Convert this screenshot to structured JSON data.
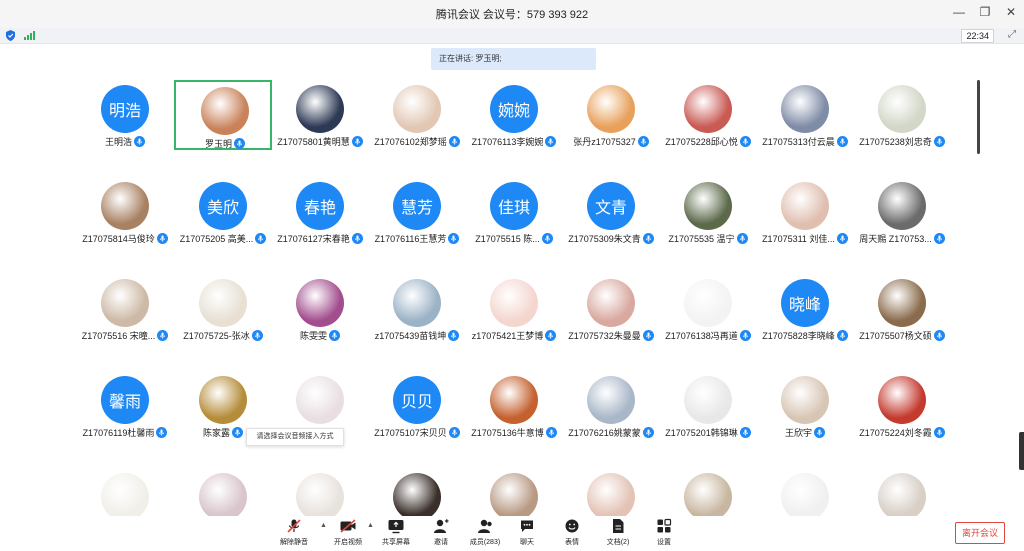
{
  "window": {
    "title": "腾讯会议 会议号：579 393 922",
    "controls": [
      "minimize-icon",
      "restore-icon",
      "close-icon"
    ]
  },
  "status": {
    "time": "22:34"
  },
  "speaking_banner": "正在讲话: 罗玉明;",
  "participants": [
    {
      "name": "王明浩",
      "avatar_text": "明浩",
      "avatar_color": "#1e88f5"
    },
    {
      "name": "罗玉明",
      "avatar_color": "#c9825a",
      "selected": true
    },
    {
      "name": "Z17075801黄明慧",
      "avatar_color": "#2d3a55"
    },
    {
      "name": "Z17076102郑梦瑶",
      "avatar_color": "#e2c8b4"
    },
    {
      "name": "Z17076113李婉婉",
      "avatar_text": "婉婉",
      "avatar_color": "#1e88f5"
    },
    {
      "name": "张丹z17075327",
      "avatar_color": "#e8a15c"
    },
    {
      "name": "Z17075228邱心悦",
      "avatar_color": "#c95a54"
    },
    {
      "name": "Z17075313付云晨",
      "avatar_color": "#7f8ca6"
    },
    {
      "name": "Z17075238刘忠奇",
      "avatar_color": "#d2d7c8"
    },
    {
      "name": "Z17075814马俊玲",
      "avatar_color": "#a88162"
    },
    {
      "name": "Z17075205 高美...",
      "avatar_text": "美欣",
      "avatar_color": "#1e88f5"
    },
    {
      "name": "Z17076127宋春艳",
      "avatar_text": "春艳",
      "avatar_color": "#1e88f5"
    },
    {
      "name": "Z17076116王慧芳",
      "avatar_text": "慧芳",
      "avatar_color": "#1e88f5"
    },
    {
      "name": "Z17075515  陈...",
      "avatar_text": "佳琪",
      "avatar_color": "#1e88f5"
    },
    {
      "name": "Z17075309朱文青",
      "avatar_text": "文青",
      "avatar_color": "#1e88f5"
    },
    {
      "name": "Z17075535 温宁",
      "avatar_color": "#5c6a4a"
    },
    {
      "name": "Z17075311 刘佳...",
      "avatar_color": "#e0bfb0"
    },
    {
      "name": "周天赐 Z170753...",
      "avatar_color": "#6b6b6b"
    },
    {
      "name": "Z17075516 宋曈...",
      "avatar_color": "#cdb9a5"
    },
    {
      "name": "Z17075725-张冰",
      "avatar_color": "#e7e0d3"
    },
    {
      "name": "陈雯雯",
      "avatar_color": "#a24d8e"
    },
    {
      "name": "z17075439苗钱坤",
      "avatar_color": "#9bb3c6"
    },
    {
      "name": "z17075421王梦博",
      "avatar_color": "#f4d6cf"
    },
    {
      "name": "Z17075732朱曼曼",
      "avatar_color": "#d9a9a0"
    },
    {
      "name": "Z17076138冯再道",
      "avatar_color": "#f3f3f3"
    },
    {
      "name": "Z17075828李晓峰",
      "avatar_text": "晓峰",
      "avatar_color": "#1e88f5"
    },
    {
      "name": "Z17075507杨文硕",
      "avatar_color": "#8a6b4c"
    },
    {
      "name": "Z17076119杜馨雨",
      "avatar_text": "馨雨",
      "avatar_color": "#1e88f5"
    },
    {
      "name": "陈家露",
      "avatar_color": "#b58d3a"
    },
    {
      "name": "",
      "avatar_color": "#e9dfe3"
    },
    {
      "name": "Z17075107宋贝贝",
      "avatar_text": "贝贝",
      "avatar_color": "#1e88f5"
    },
    {
      "name": "Z17075136牛意博",
      "avatar_color": "#c4612f"
    },
    {
      "name": "Z17076216姚蒙蒙",
      "avatar_color": "#a9b7c8"
    },
    {
      "name": "Z17075201韩锦琳",
      "avatar_color": "#e8e8e8"
    },
    {
      "name": "王欣宇",
      "avatar_color": "#d8c6b5"
    },
    {
      "name": "Z17075224刘冬霞",
      "avatar_color": "#c43a2f"
    },
    {
      "name": "",
      "avatar_color": "#f1efe8"
    },
    {
      "name": "",
      "avatar_color": "#d9c5cc"
    },
    {
      "name": "",
      "avatar_color": "#e8e2dc"
    },
    {
      "name": "",
      "avatar_color": "#3a2f2a"
    },
    {
      "name": "",
      "avatar_color": "#b89a84"
    },
    {
      "name": "",
      "avatar_color": "#e3c3b5"
    },
    {
      "name": "",
      "avatar_color": "#c8b7a0"
    },
    {
      "name": "",
      "avatar_color": "#f0f0f0"
    },
    {
      "name": "",
      "avatar_color": "#d8cfc6"
    }
  ],
  "tooltip": "请选择会议音频接入方式",
  "toolbar": {
    "unmute": "解除静音",
    "start_video": "开启视频",
    "share_screen": "共享屏幕",
    "invite": "邀请",
    "members": "成员(283)",
    "chat": "聊天",
    "reactions": "表情",
    "docs": "文档(2)",
    "settings": "设置",
    "leave": "离开会议"
  }
}
